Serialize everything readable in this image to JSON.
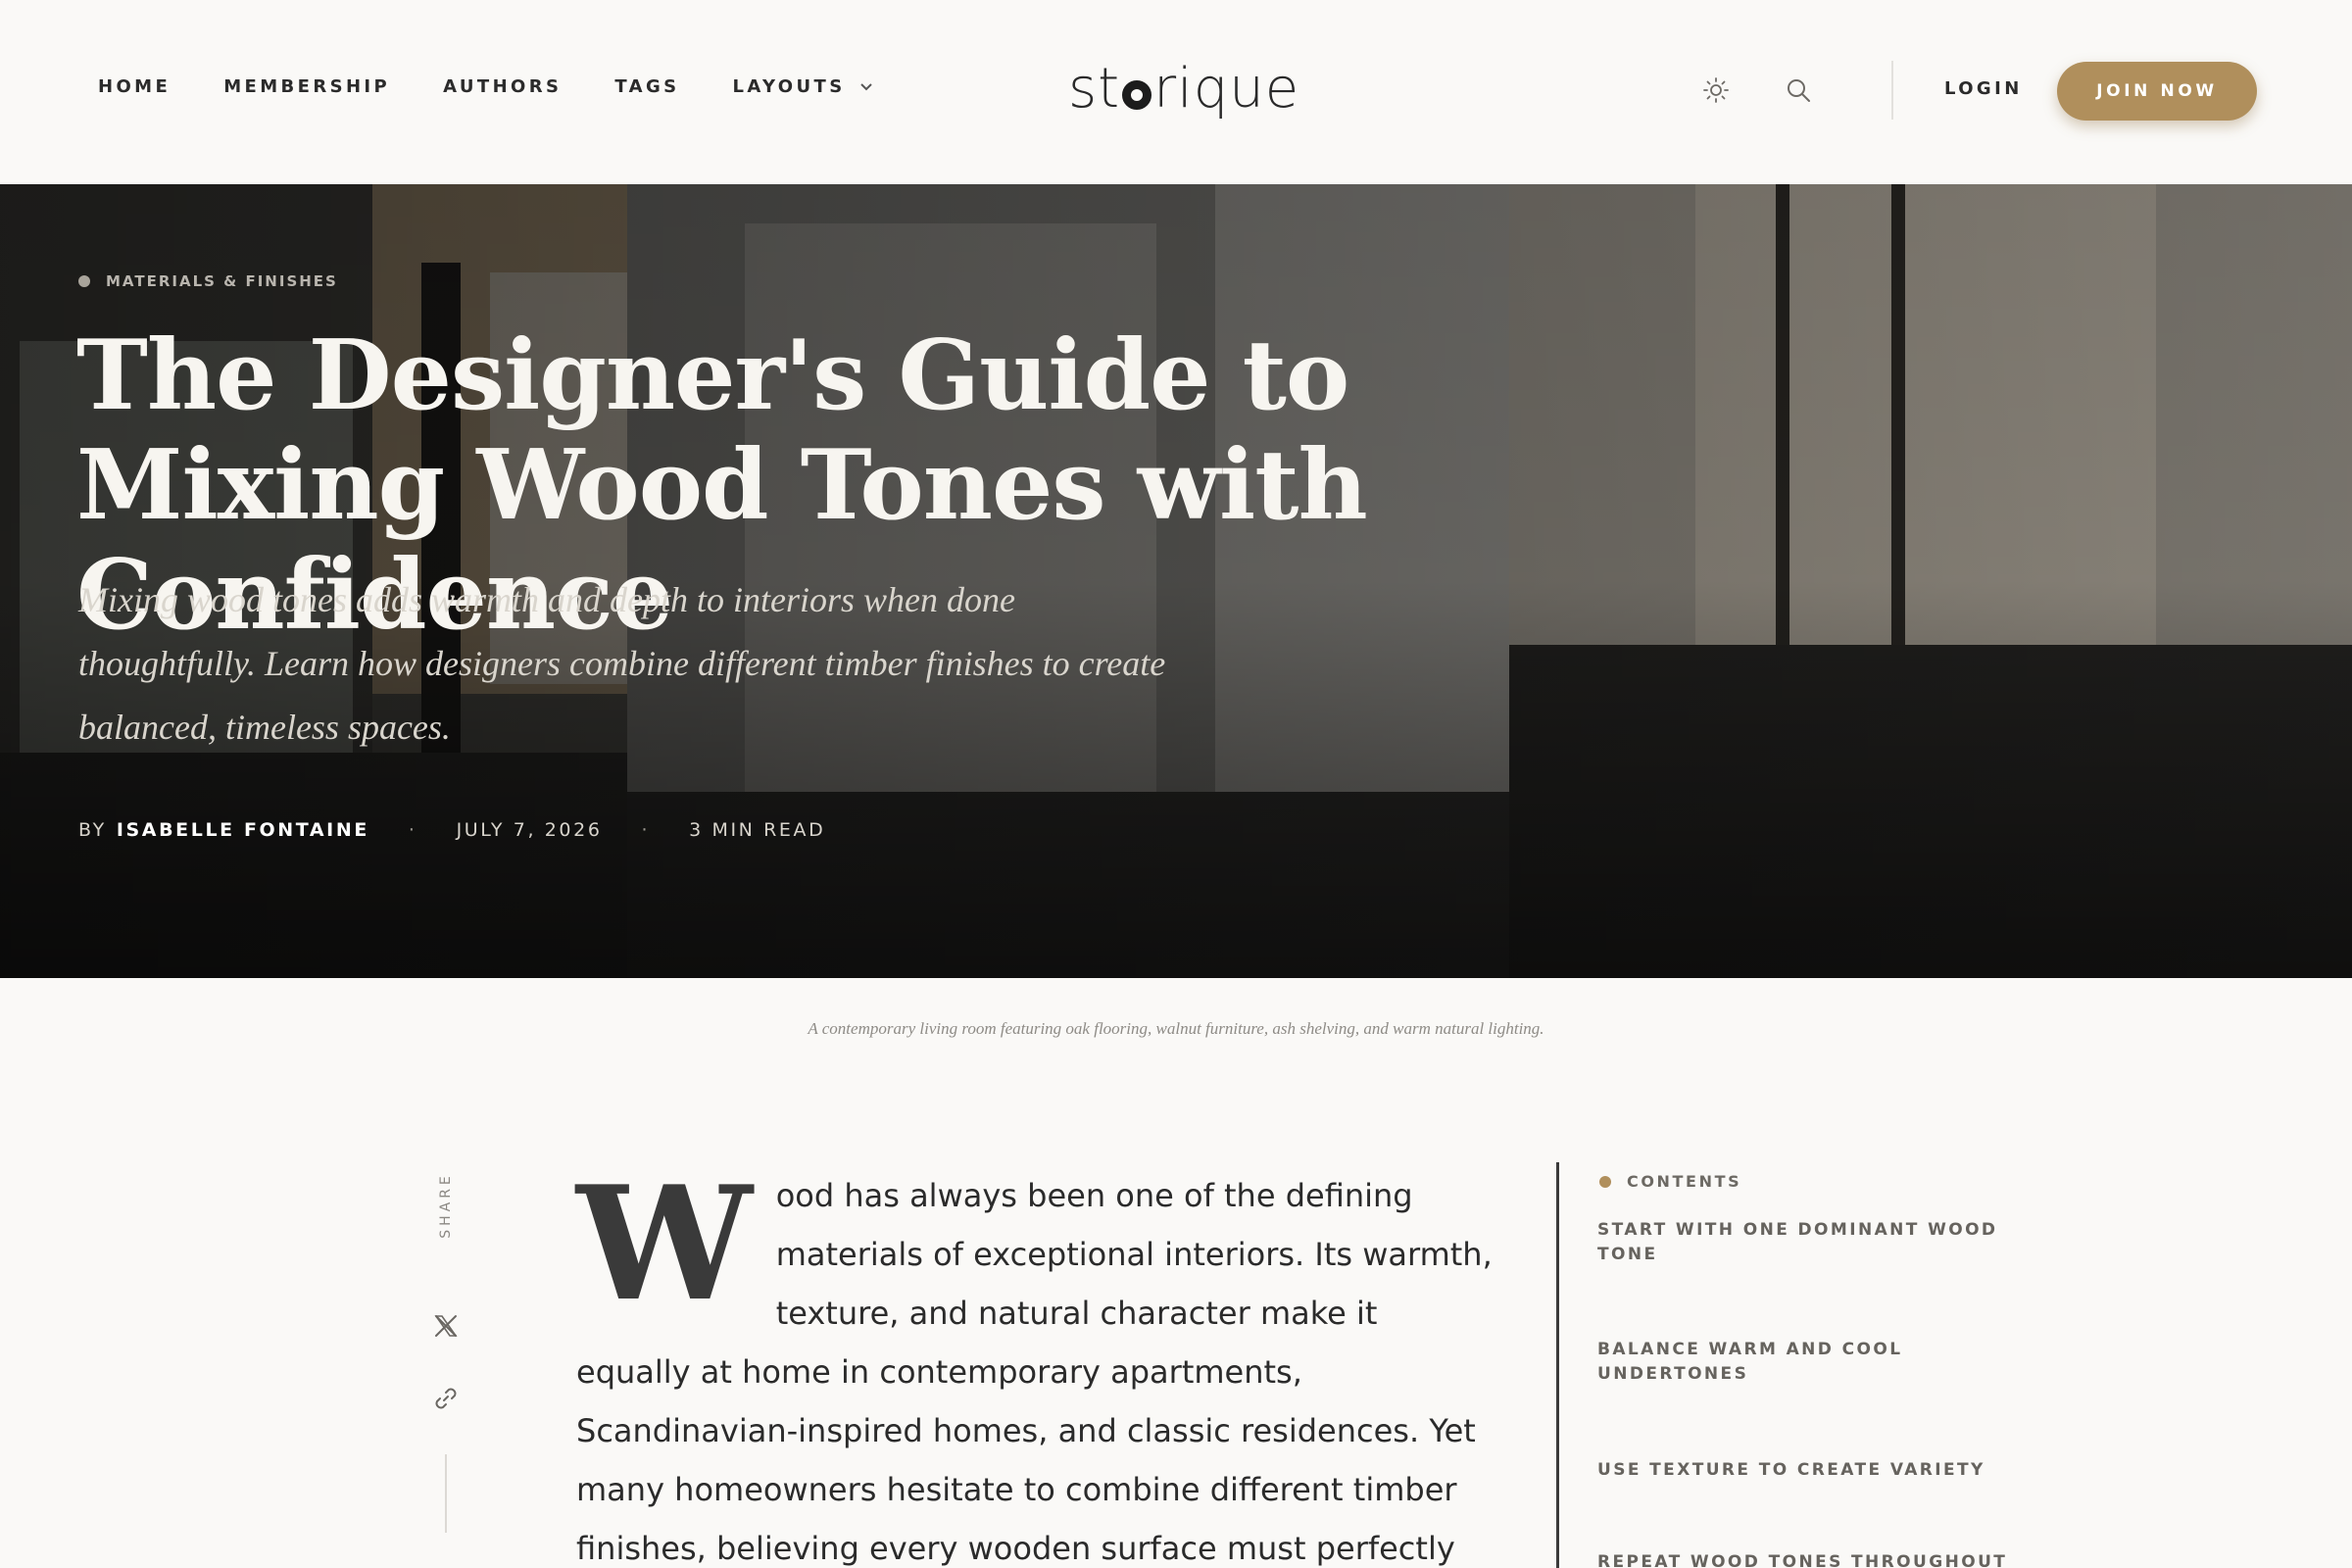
{
  "nav": {
    "items": [
      {
        "label": "HOME"
      },
      {
        "label": "MEMBERSHIP"
      },
      {
        "label": "AUTHORS"
      },
      {
        "label": "TAGS"
      },
      {
        "label": "LAYOUTS"
      }
    ]
  },
  "logo": {
    "part1": "st",
    "part2": "rique",
    "icon": "ring-o-logo"
  },
  "header": {
    "login_label": "LOGIN",
    "join_label": "JOIN NOW",
    "theme_icon": "sun-icon",
    "search_icon": "search-icon",
    "accent": "#b08f5c"
  },
  "hero": {
    "tag": "MATERIALS & FINISHES",
    "title": "The Designer's Guide to Mixing Wood Tones with Confidence",
    "subtitle": "Mixing wood tones adds warmth and depth to interiors when done thoughtfully. Learn how designers combine different timber finishes to create balanced, timeless spaces.",
    "by": "BY",
    "author": "ISABELLE FONTAINE",
    "separator": "·",
    "date": "JULY 7, 2026",
    "read_time": "3 MIN READ"
  },
  "caption": "A contemporary living room featuring oak flooring, walnut furniture, ash shelving, and warm natural lighting.",
  "share": {
    "label": "SHARE",
    "icons": [
      "x-icon",
      "link-icon"
    ]
  },
  "article": {
    "dropcap": "W",
    "body": "ood has always been one of the defining materials of exceptional interiors. Its warmth, texture, and natural character make it equally at home in contemporary apartments, Scandinavian-inspired homes, and classic residences. Yet many homeowners hesitate to combine different timber finishes, believing every wooden surface must perfectly match."
  },
  "toc": {
    "heading": "CONTENTS",
    "items": [
      {
        "label": "START WITH ONE DOMINANT WOOD TONE"
      },
      {
        "label": "BALANCE WARM AND COOL UNDERTONES"
      },
      {
        "label": "USE TEXTURE TO CREATE VARIETY"
      },
      {
        "label": "REPEAT WOOD TONES THROUGHOUT"
      }
    ]
  }
}
